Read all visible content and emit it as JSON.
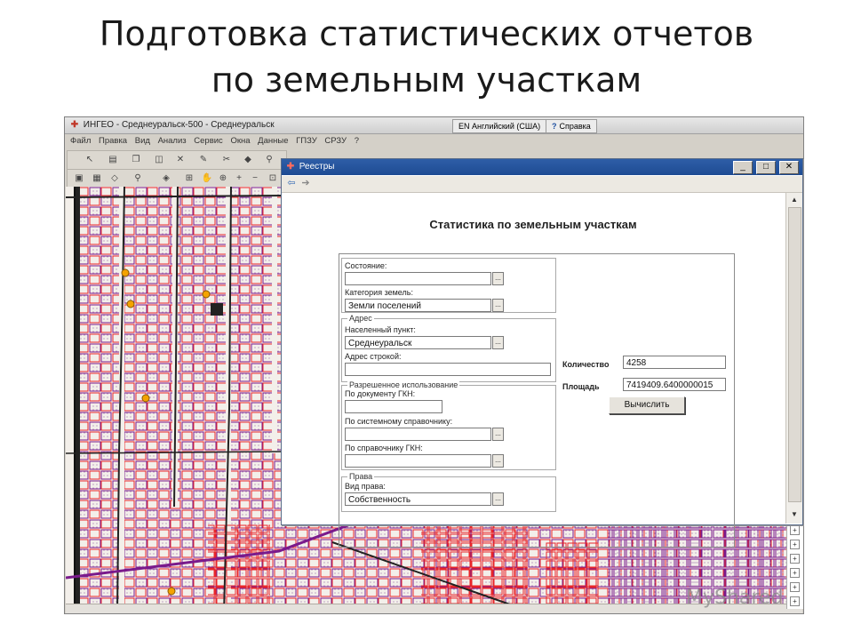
{
  "slide": {
    "title_line1": "Подготовка статистических отчетов",
    "title_line2": "по земельным участкам"
  },
  "app": {
    "title": "ИНГЕО - Среднеуральск-500 - Среднеуральск",
    "language": "EN Английский (США)",
    "help": "Справка",
    "menu": [
      "Файл",
      "Правка",
      "Вид",
      "Анализ",
      "Сервис",
      "Окна",
      "Данные",
      "ГПЗУ",
      "СРЗУ",
      "?"
    ]
  },
  "dialog": {
    "title": "Реестры",
    "heading": "Статистика по земельным участкам",
    "state_label": "Состояние:",
    "state_value": "",
    "category_label": "Категория земель:",
    "category_value": "Земли поселений",
    "address_group": "Адрес",
    "settlement_label": "Населенный пункт:",
    "settlement_value": "Среднеуральск",
    "address_string_label": "Адрес строкой:",
    "address_string_value": "",
    "permitted_use_group": "Разрешенное использование",
    "by_gkn_doc_label": "По документу ГКН:",
    "by_system_ref_label": "По системному справочнику:",
    "by_gkn_ref_label": "По справочнику ГКН:",
    "rights_group": "Права",
    "right_type_label": "Вид права:",
    "right_type_value": "Собственность",
    "count_label": "Количество",
    "count_value": "4258",
    "area_label": "Площадь",
    "area_value": "7419409.6400000015",
    "calc_button": "Вычислить",
    "browse": "..."
  },
  "watermark": "MyShared",
  "colors": {
    "parcel_red": "#e8262a",
    "parcel_purple": "#7a1a8c",
    "titlebar_blue": "#1e4b93",
    "marker_orange": "#f4a300"
  }
}
